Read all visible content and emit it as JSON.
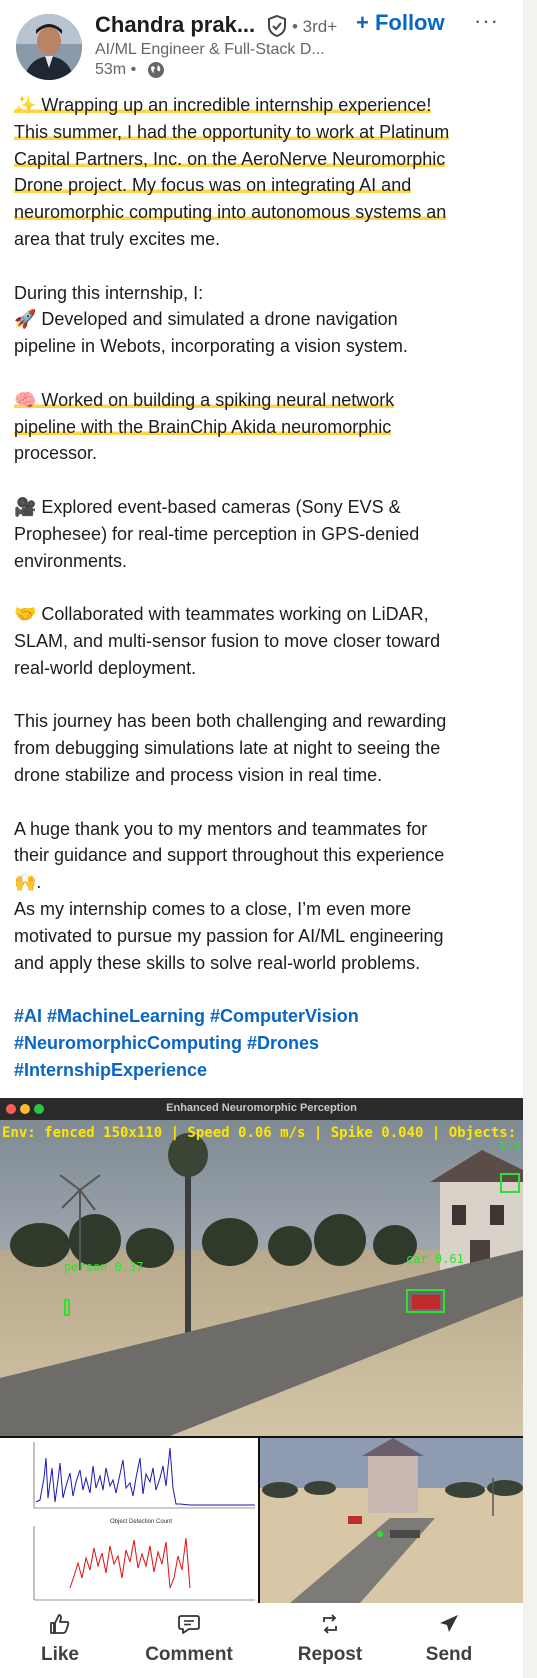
{
  "author": {
    "name": "Chandra prak...",
    "degree": "• 3rd+",
    "headline": "AI/ML Engineer & Full-Stack D...",
    "time": "53m •"
  },
  "header": {
    "follow_label": "+ Follow",
    "more_label": "···"
  },
  "post": {
    "p1": [
      "✨ Wrapping up an incredible internship experience!",
      "This summer, I had the opportunity to work at Platinum",
      "Capital Partners, Inc. on the AeroNerve Neuromorphic",
      "Drone project. My focus was on integrating AI and",
      "neuromorphic computing into autonomous systems an",
      "area that truly excites me."
    ],
    "p2": "During this internship, I:",
    "p3": [
      "🚀 Developed and simulated a drone navigation",
      "pipeline in Webots, incorporating a vision system."
    ],
    "p4": [
      "🧠 Worked on building a spiking neural network",
      "pipeline with the BrainChip Akida neuromorphic",
      "processor."
    ],
    "p5": [
      "🎥 Explored event-based cameras (Sony EVS &",
      "Prophesee) for real-time perception in GPS-denied",
      "environments."
    ],
    "p6": [
      "🤝 Collaborated with teammates working on LiDAR,",
      "SLAM, and multi-sensor fusion to move closer toward",
      "real-world deployment."
    ],
    "p7": [
      "This journey has been both challenging and rewarding",
      "from debugging simulations late at night to seeing the",
      "drone stabilize and process vision in real time."
    ],
    "p8": [
      "A huge thank you to my mentors and teammates for",
      "their guidance and support throughout this experience",
      "🙌."
    ],
    "p9": [
      "As my internship comes to a close, I’m even more",
      "motivated to pursue my passion for AI/ML engineering",
      "and apply these skills to solve real-world problems."
    ],
    "hashtags": [
      "#AI #MachineLearning #ComputerVision",
      " #NeuromorphicComputing #Drones",
      " #InternshipExperience"
    ]
  },
  "media": {
    "window_title": "Enhanced Neuromorphic Perception",
    "hud": "Env: fenced 150x110 | Speed 0.06 m/s | Spike 0.040 | Objects:",
    "detections": {
      "person": "person 0.37",
      "car": "car 0.61",
      "clock": "clo"
    },
    "plot_bottom_title": "Object Detection Count"
  },
  "actions": {
    "like": "Like",
    "comment": "Comment",
    "repost": "Repost",
    "send": "Send"
  },
  "colors": {
    "link": "#0a66c2",
    "highlight": "#ffcd28",
    "hud": "#ffe600",
    "detection": "#30e030"
  }
}
